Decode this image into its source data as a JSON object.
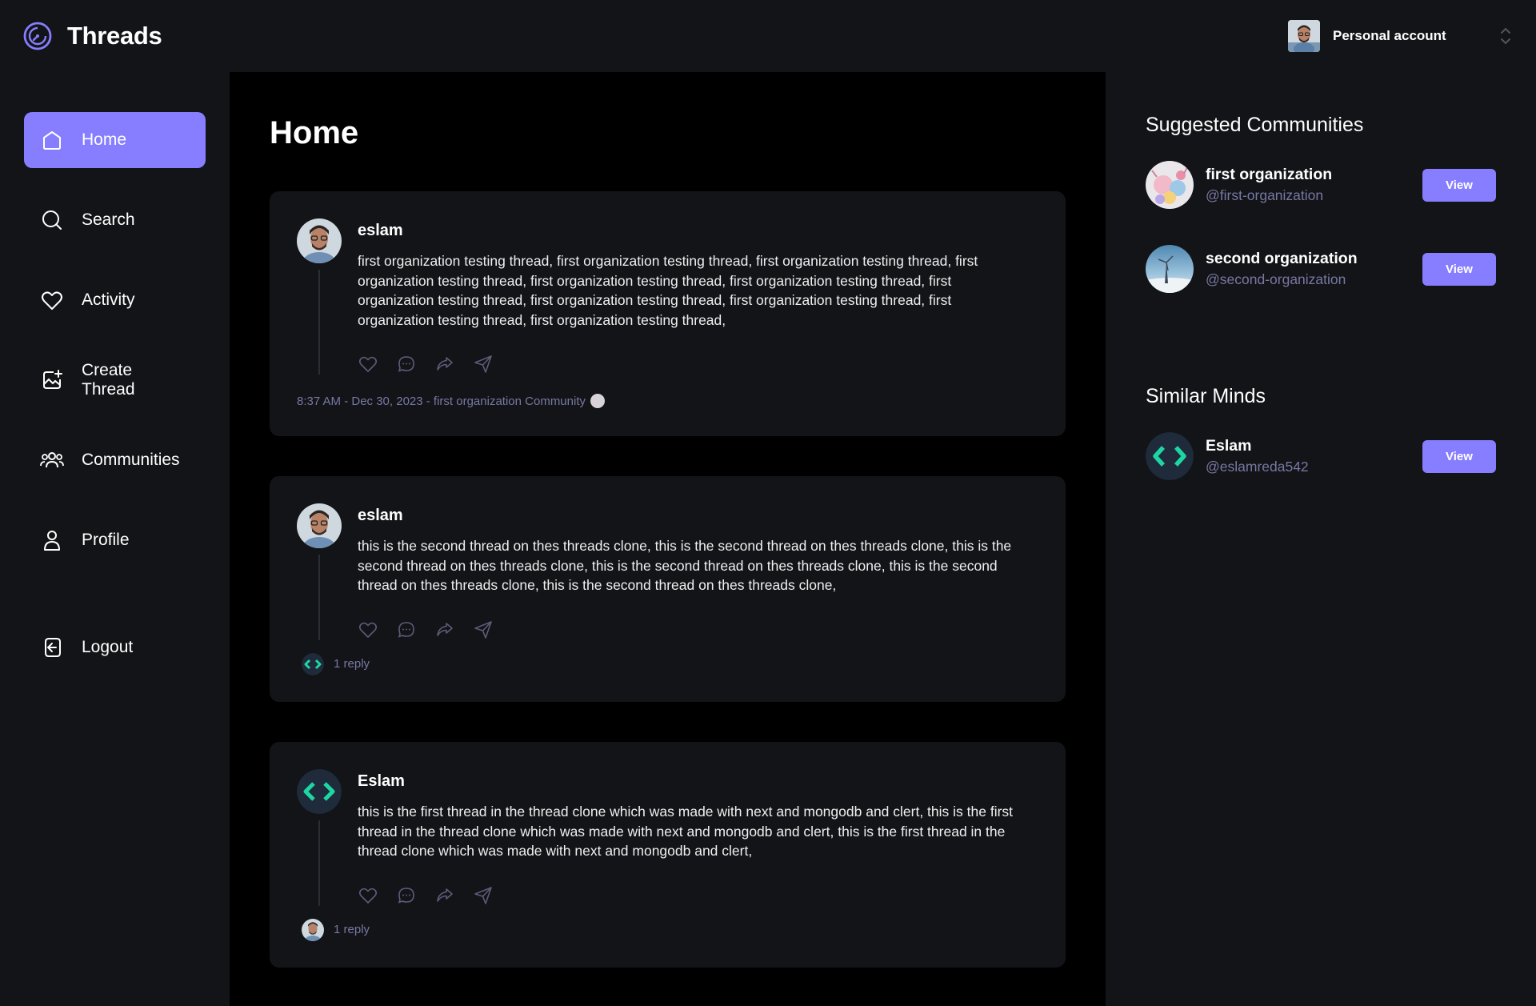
{
  "app": {
    "name": "Threads"
  },
  "topbar": {
    "account_label": "Personal account"
  },
  "sidebar": {
    "items": [
      {
        "label": "Home",
        "icon": "home-icon",
        "active": true
      },
      {
        "label": "Search",
        "icon": "search-icon"
      },
      {
        "label": "Activity",
        "icon": "heart-icon"
      },
      {
        "label": "Create Thread",
        "icon": "create-thread-icon"
      },
      {
        "label": "Communities",
        "icon": "communities-icon"
      },
      {
        "label": "Profile",
        "icon": "user-icon"
      }
    ],
    "logout_label": "Logout"
  },
  "main": {
    "title": "Home",
    "threads": [
      {
        "author": "eslam",
        "text": "first organization testing thread, first organization testing thread, first organization testing thread, first organization testing thread, first organization testing thread, first organization testing thread, first organization testing thread, first organization testing thread, first organization testing thread, first organization testing thread, first organization testing thread,",
        "meta": "8:37 AM - Dec 30, 2023 - first organization Community"
      },
      {
        "author": "eslam",
        "text": "this is the second thread on thes threads clone, this is the second thread on thes threads clone, this is the second thread on thes threads clone, this is the second thread on thes threads clone, this is the second thread on thes threads clone, this is the second thread on thes threads clone,",
        "reply": "1 reply"
      },
      {
        "author": "Eslam",
        "text": "this is the first thread in the thread clone which was made with next and mongodb and clert, this is the first thread in the thread clone which was made with next and mongodb and clert, this is the first thread in the thread clone which was made with next and mongodb and clert,",
        "reply": "1 reply"
      }
    ]
  },
  "rightbar": {
    "communities_title": "Suggested Communities",
    "communities": [
      {
        "name": "first organization",
        "handle": "@first-organization",
        "button": "View"
      },
      {
        "name": "second organization",
        "handle": "@second-organization",
        "button": "View"
      }
    ],
    "minds_title": "Similar Minds",
    "minds": [
      {
        "name": "Eslam",
        "handle": "@eslamreda542",
        "button": "View"
      }
    ]
  },
  "colors": {
    "accent": "#877eff",
    "panel": "#121417",
    "main_bg": "#000000",
    "muted": "#7878a3"
  }
}
